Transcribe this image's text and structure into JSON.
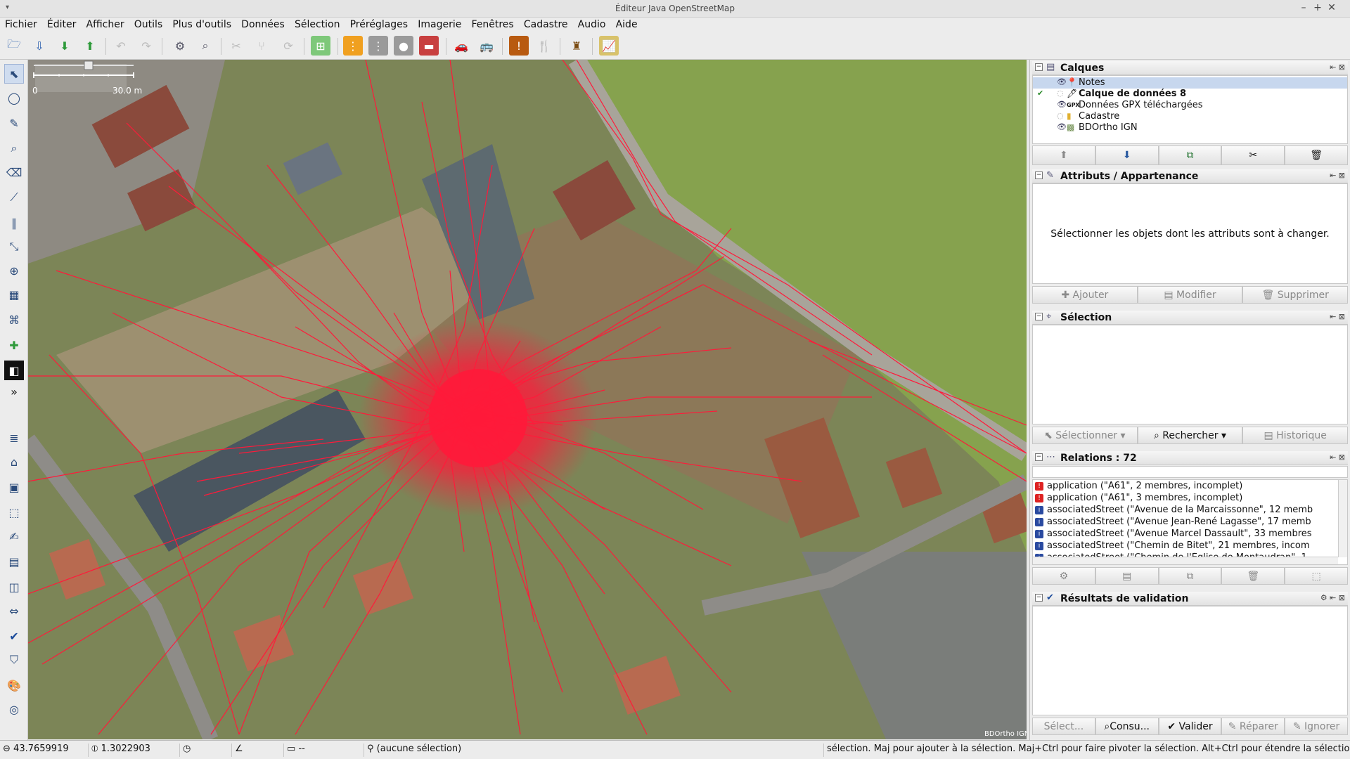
{
  "window": {
    "title": "Éditeur Java OpenStreetMap",
    "menu_glyph": "▾",
    "controls": [
      "–",
      "+",
      "✕"
    ]
  },
  "menu": [
    "Fichier",
    "Éditer",
    "Afficher",
    "Outils",
    "Plus d'outils",
    "Données",
    "Sélection",
    "Préréglages",
    "Imagerie",
    "Fenêtres",
    "Cadastre",
    "Audio",
    "Aide"
  ],
  "toolbar_icons": [
    "open-icon",
    "open-location-icon",
    "download-icon",
    "upload-icon",
    "undo-icon",
    "redo-icon",
    "preferences-icon",
    "zoom-icon",
    "split-icon",
    "merge-icon",
    "refresh-icon",
    "imagery-icon",
    "road-preset-icon",
    "street-preset-icon",
    "traffic-light-preset-icon",
    "building-preset-icon",
    "car-preset-icon",
    "bus-preset-icon",
    "hazard-preset-icon",
    "restaurant-preset-icon",
    "castle-preset-icon",
    "elevation-profile-icon"
  ],
  "scale": {
    "start": "0",
    "end": "30.0 m"
  },
  "imagery_attribution": "BDOrtho IGN",
  "panels": {
    "layers": {
      "title": "Calques",
      "items": [
        {
          "name": "Notes",
          "selected": true,
          "icon": "📍"
        },
        {
          "name": "Calque de données 8",
          "bold": true,
          "active": true,
          "icon": "🖊"
        },
        {
          "name": "Données GPX téléchargées",
          "icon": "GPX"
        },
        {
          "name": "Cadastre",
          "icon": "📁"
        },
        {
          "name": "BDOrtho IGN",
          "icon": "🗺"
        }
      ]
    },
    "attributes": {
      "title": "Attributs / Appartenance",
      "hint": "Sélectionner les objets dont les attributs sont à changer.",
      "buttons": [
        "Ajouter",
        "Modifier",
        "Supprimer"
      ]
    },
    "selection": {
      "title": "Sélection",
      "buttons": [
        "Sélectionner",
        "Rechercher",
        "Historique"
      ]
    },
    "relations": {
      "title": "Relations : 72",
      "items": [
        "application (\"A61\", 2 membres, incomplet)",
        "application (\"A61\", 3 membres, incomplet)",
        "associatedStreet (\"Avenue de la Marcaissonne\", 12 memb",
        "associatedStreet (\"Avenue Jean-René Lagasse\", 17 memb",
        "associatedStreet (\"Avenue Marcel Dassault\", 33 membres",
        "associatedStreet (\"Chemin de Bitet\", 21 membres, incom",
        "associatedStreet (\"Chemin de l'Église de Montaudran\", 1"
      ]
    },
    "validation": {
      "title": "Résultats de validation",
      "buttons": [
        "Sélect...",
        "Consu...",
        "Valider",
        "Réparer",
        "Ignorer"
      ]
    }
  },
  "status": {
    "lat": "43.7659919",
    "lon": "1.3022903",
    "distance": "--",
    "selection": "(aucune sélection)",
    "help": "sélection. Maj pour ajouter à la sélection. Maj+Ctrl pour faire pivoter la sélection. Alt+Ctrl pour étendre la sélection."
  },
  "colors": {
    "gpx_track": "#ff1a3a",
    "selected_layer": "#c7d7ee"
  }
}
